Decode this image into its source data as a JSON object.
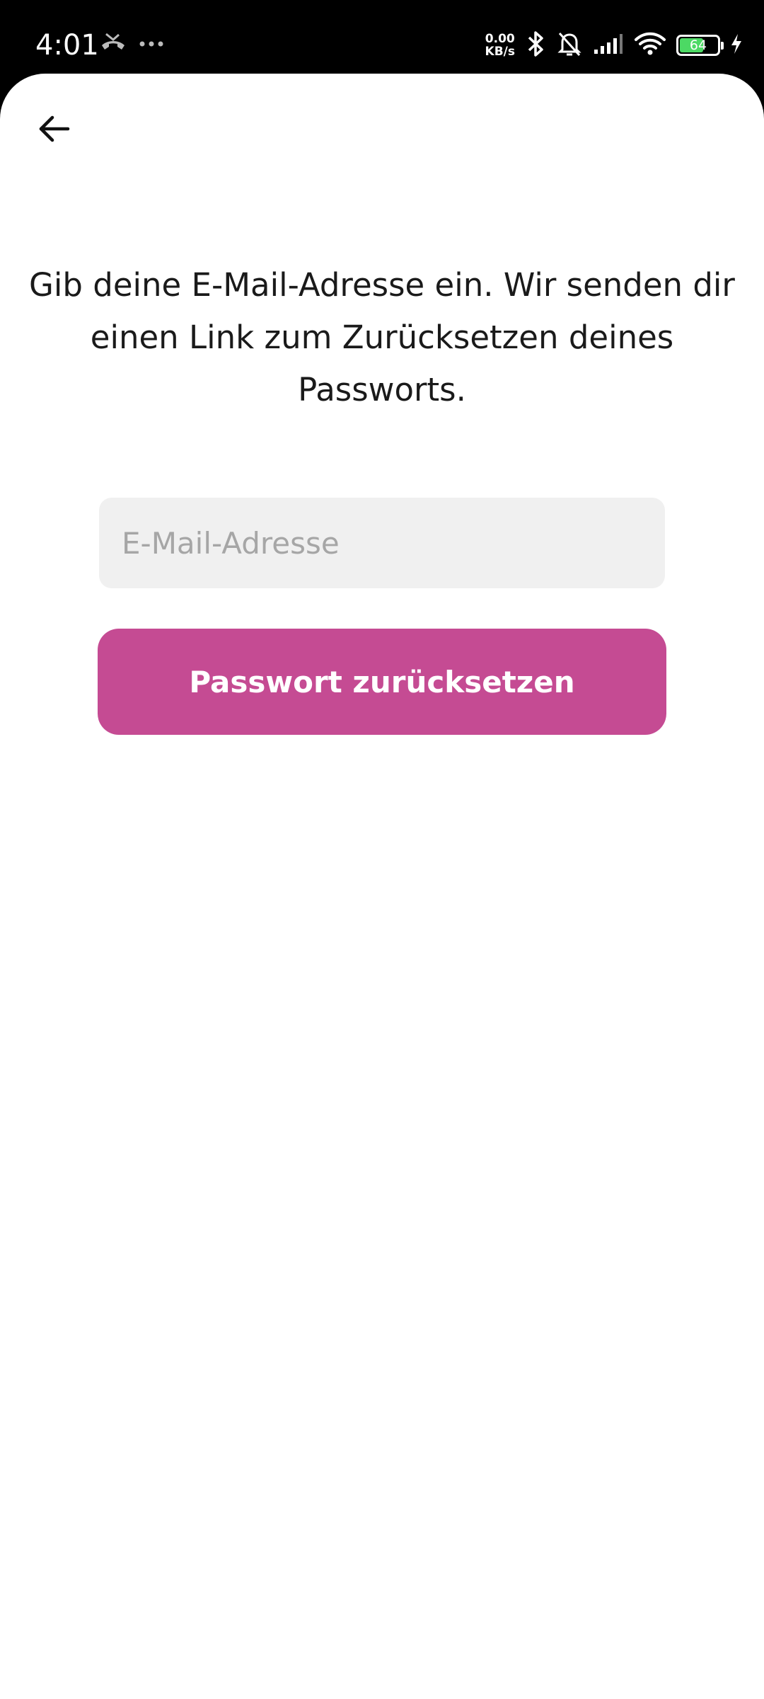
{
  "status_bar": {
    "time": "4:01",
    "net_speed_value": "0.00",
    "net_speed_unit": "KB/s",
    "battery_level": "64",
    "icons": [
      "missed-call-icon",
      "more-dots-icon",
      "bluetooth-icon",
      "bell-muted-icon",
      "signal-icon",
      "wifi-icon",
      "battery-icon",
      "charging-icon"
    ]
  },
  "nav": {
    "back_icon": "arrow-left-icon"
  },
  "content": {
    "instruction": "Gib deine E-Mail-Adresse ein. Wir senden dir einen Link zum Zurücksetzen deines Passworts.",
    "email_value": "",
    "email_placeholder": "E-Mail-Adresse",
    "submit_label": "Passwort zurücksetzen"
  },
  "colors": {
    "accent": "#c54b93",
    "input_background": "#f0f0f0",
    "battery_fill": "#4cd964"
  }
}
